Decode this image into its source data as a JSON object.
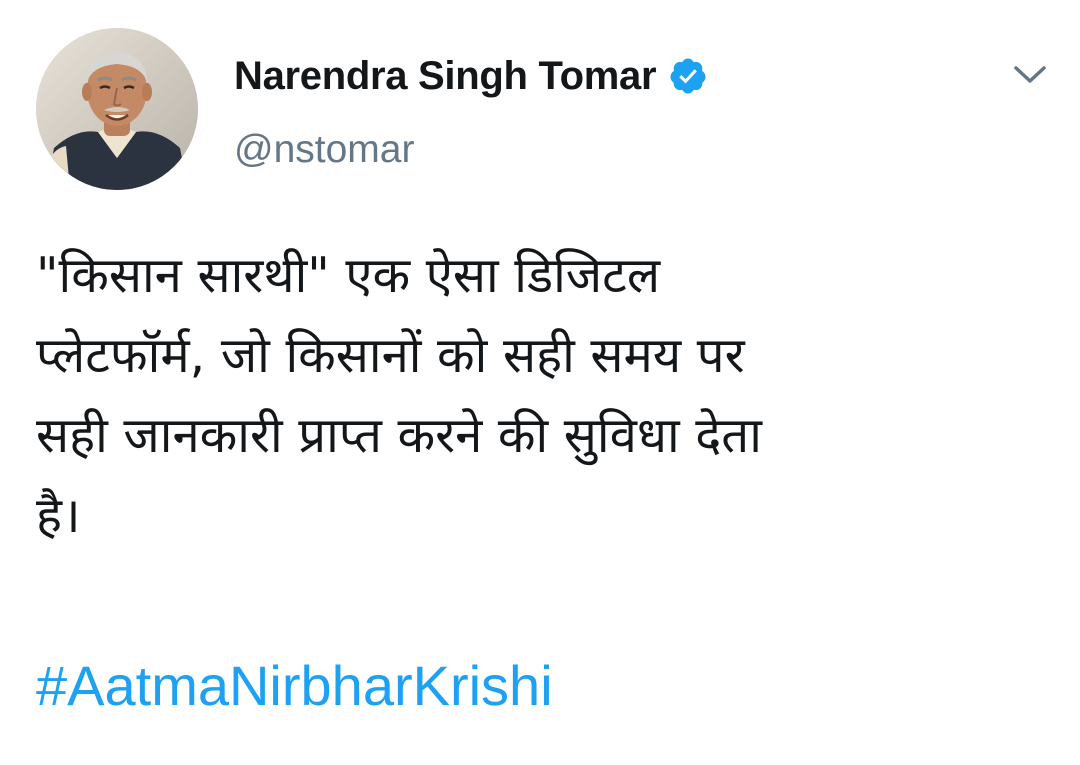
{
  "author": {
    "display_name": "Narendra Singh Tomar",
    "handle": "@nstomar",
    "verified": true,
    "avatar_icon": "profile-photo"
  },
  "menu": {
    "icon": "chevron-down-icon"
  },
  "tweet": {
    "text_lines": [
      "\"किसान सारथी\" एक ऐसा डिजिटल",
      "प्लेटफॉर्म, जो किसानों को सही समय पर",
      "सही जानकारी प्राप्त करने की सुविधा देता",
      "है।"
    ],
    "hashtag": "#AatmaNirbharKrishi"
  },
  "colors": {
    "text": "#14171a",
    "secondary": "#657786",
    "accent": "#1da1f2"
  }
}
